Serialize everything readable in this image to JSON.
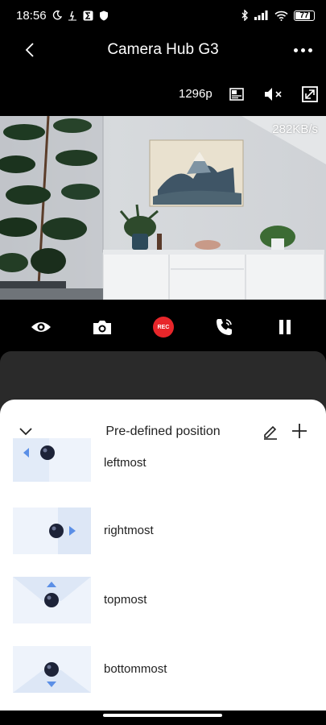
{
  "status": {
    "time": "18:56",
    "battery": "77"
  },
  "header": {
    "title": "Camera Hub G3"
  },
  "toolbar": {
    "resolution": "1296p"
  },
  "video": {
    "bitrate": "282KB/s"
  },
  "controls": {
    "rec_label": "REC"
  },
  "sheet": {
    "title": "Pre-defined position",
    "items": [
      {
        "label": "leftmost",
        "icon": "arrow-left-icon"
      },
      {
        "label": "rightmost",
        "icon": "arrow-right-icon"
      },
      {
        "label": "topmost",
        "icon": "arrow-up-icon"
      },
      {
        "label": "bottommost",
        "icon": "arrow-down-icon"
      }
    ]
  },
  "colors": {
    "accent_rec": "#e8262a",
    "thumb_bg": "#eef3fb",
    "thumb_wedge": "#d8e4f5",
    "arrow_blue": "#5b8fe6",
    "camera_dark": "#1d2338"
  }
}
